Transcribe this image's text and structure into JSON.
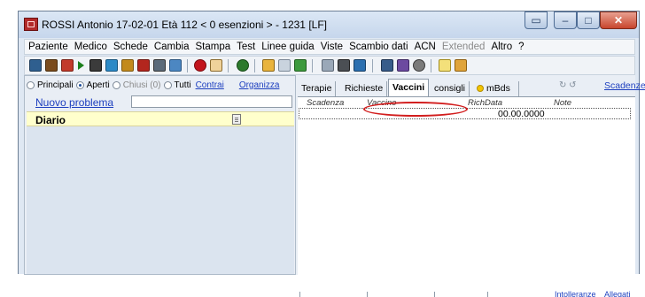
{
  "window": {
    "title": "ROSSI Antonio  17-02-01  Età 112  < 0 esenzioni >  - 1231  [LF]",
    "controls": [
      "restore",
      "minimize",
      "maximize",
      "close"
    ]
  },
  "menu": {
    "items": [
      {
        "label": "Paziente",
        "disabled": false
      },
      {
        "label": "Medico",
        "disabled": false
      },
      {
        "label": "Schede",
        "disabled": false
      },
      {
        "label": "Cambia",
        "disabled": false
      },
      {
        "label": "Stampa",
        "disabled": false
      },
      {
        "label": "Test",
        "disabled": false
      },
      {
        "label": "Linee guida",
        "disabled": false
      },
      {
        "label": "Viste",
        "disabled": false
      },
      {
        "label": "Scambio dati",
        "disabled": false
      },
      {
        "label": "ACN",
        "disabled": false
      },
      {
        "label": "Extended",
        "disabled": true
      },
      {
        "label": "Altro",
        "disabled": false
      },
      {
        "label": "?",
        "disabled": false
      }
    ]
  },
  "toolbar": {
    "icons": [
      "patient-card-icon",
      "bank-icon",
      "scale-icon",
      "play-icon",
      "document-list-icon",
      "filter-icon",
      "family-icon",
      "pills-icon",
      "chart-edit-icon",
      "calendar-icon",
      "alert-icon",
      "hand-icon",
      "person-icon",
      "syringe-icon",
      "table-icon",
      "spreadsheet-icon",
      "copy-icon",
      "printer-icon",
      "network-icon",
      "grid-icon",
      "mail-edit-icon",
      "phone-icon",
      "help-icon",
      "info-icon"
    ]
  },
  "filters": {
    "options": [
      {
        "label": "Principali",
        "selected": false,
        "disabled": false
      },
      {
        "label": "Aperti",
        "selected": true,
        "disabled": false
      },
      {
        "label": "Chiusi (0)",
        "selected": false,
        "disabled": true
      },
      {
        "label": "Tutti",
        "selected": false,
        "disabled": false
      }
    ],
    "contrai_link": "Contrai",
    "organizza_link": "Organizza"
  },
  "problems": {
    "new_link": "Nuovo problema",
    "new_input_value": "",
    "diario_label": "Diario"
  },
  "tabs": {
    "items": [
      "Terapie",
      "Richieste",
      "Vaccini",
      "consigli",
      "mBds"
    ],
    "active": "Vaccini",
    "nav_arrows": "↻ ↺",
    "scadenze_link": "Scadenze"
  },
  "vaccini_grid": {
    "columns": [
      "Scadenza",
      "Vaccino",
      "RichData",
      "Note"
    ],
    "rows": [
      {
        "scadenza": "",
        "vaccino": "",
        "richdata": "00.00.0000",
        "note": ""
      }
    ]
  },
  "bottom": {
    "links": [
      "Intolleranze",
      "Allegati"
    ]
  },
  "colors": {
    "annotation_circle": "#d21d1d",
    "diario_background": "#ffffcc",
    "link": "#1d3fbf"
  }
}
